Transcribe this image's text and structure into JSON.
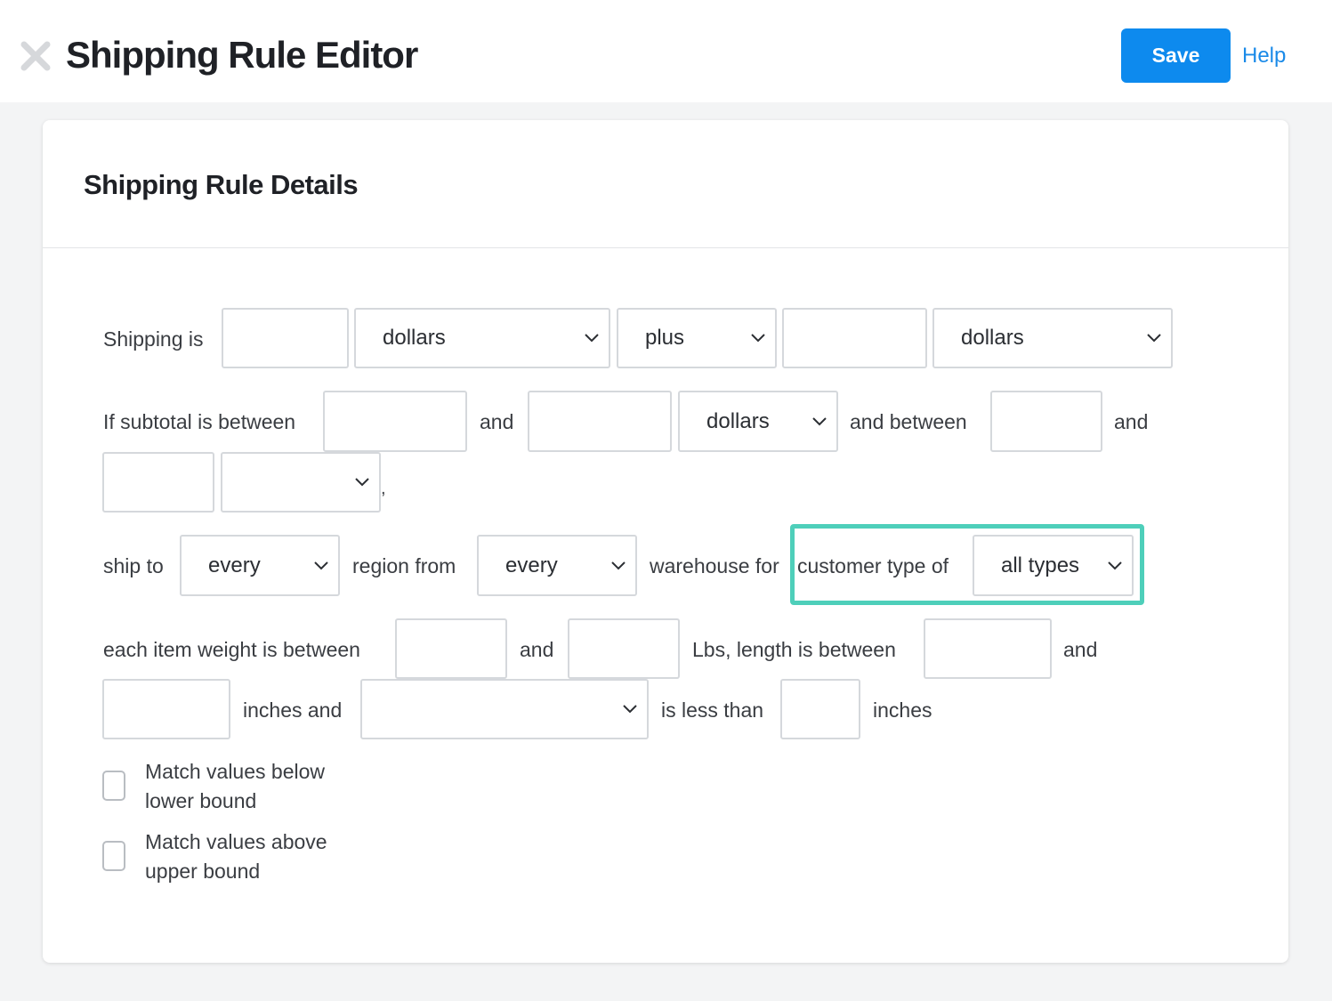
{
  "header": {
    "title": "Shipping Rule Editor",
    "save_label": "Save",
    "help_label": "Help",
    "close_icon": "close-icon"
  },
  "card": {
    "title": "Shipping Rule Details"
  },
  "rule": {
    "row1": {
      "label_shipping_is": "Shipping is",
      "amount_value": "",
      "currency1": "dollars",
      "operator": "plus",
      "amount2_value": "",
      "currency2": "dollars"
    },
    "row2": {
      "label_subtotal": "If subtotal is between",
      "min_value": "",
      "label_and1": "and",
      "max_value": "",
      "currency": "dollars",
      "label_and_between": "and between",
      "min2_value": "",
      "label_and2": "and",
      "max2_value": "",
      "unit": "",
      "comma": ","
    },
    "row3": {
      "label_ship_to": "ship to",
      "region": "every",
      "label_region_from": "region from",
      "warehouse": "every",
      "label_warehouse_for": "warehouse for",
      "label_customer_type": "customer type of",
      "customer_type": "all types"
    },
    "row4": {
      "label_weight": "each item weight is between",
      "weight_min": "",
      "label_and1": "and",
      "weight_max": "",
      "label_lbs_length": "Lbs, length is between",
      "length_min": "",
      "label_and2": "and",
      "length_max": "",
      "label_inches_and": "inches and",
      "dimension": "",
      "label_less_than": "is less than",
      "dimension_value": "",
      "label_inches": "inches"
    },
    "options": {
      "match_below": "Match values below lower bound",
      "match_below_line1": "Match values below",
      "match_below_line2": "lower bound",
      "match_above_line1": "Match values above",
      "match_above_line2": "upper bound"
    }
  },
  "colors": {
    "accent": "#0d8aee",
    "highlight": "#4ecfba",
    "background": "#f3f4f5"
  }
}
